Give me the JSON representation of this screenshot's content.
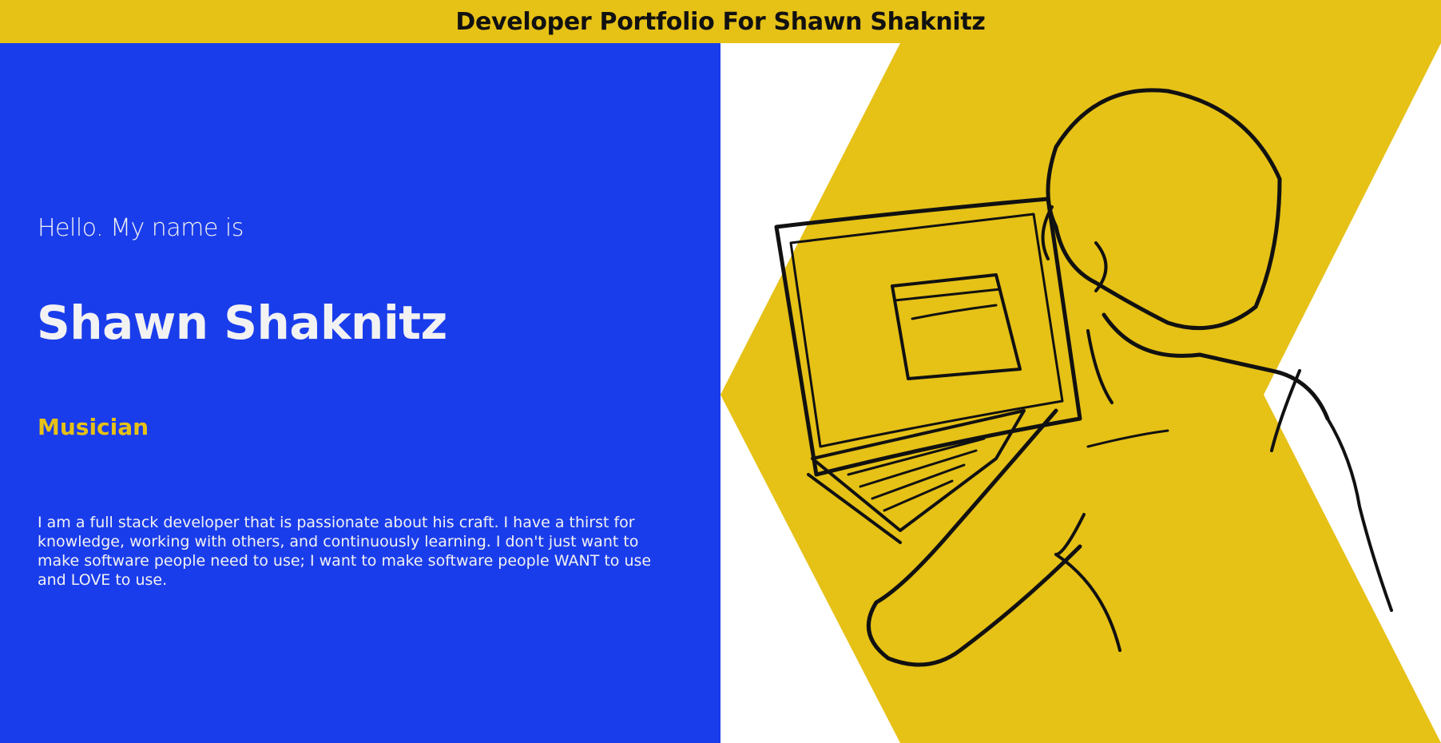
{
  "header": {
    "title": "Developer Portfolio For Shawn Shaknitz"
  },
  "hero": {
    "greeting": "Hello. My name is",
    "name": "Shawn Shaknitz",
    "role": "Musician",
    "bio": "I am a full stack developer that is passionate about his craft. I have a thirst for knowledge, working with others, and continuously learning. I don't just want to make software people need to use; I want to make software people WANT to use and LOVE to use."
  },
  "colors": {
    "accent_yellow": "#e6c116",
    "hero_blue": "#1a3deb",
    "text_light": "#f2f2f2",
    "text_dark": "#111111"
  },
  "illustration": {
    "icon": "developer-at-laptop-illustration"
  }
}
